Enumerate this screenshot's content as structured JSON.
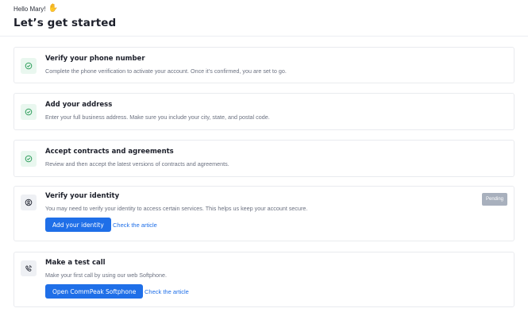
{
  "header": {
    "greeting": "Hello Mary!",
    "title": "Let’s get started"
  },
  "steps": [
    {
      "title": "Verify your phone number",
      "description": "Complete the phone verification to activate your account. Once it’s confirmed, you are set to go.",
      "status": "completed",
      "icon": "check-circle-icon"
    },
    {
      "title": "Add your address",
      "description": "Enter your full business address. Make sure you include your city, state, and postal code.",
      "status": "completed",
      "icon": "check-circle-icon"
    },
    {
      "title": "Accept contracts and agreements",
      "description": "Review and then accept the latest versions of contracts and agreements.",
      "status": "completed",
      "icon": "check-circle-icon"
    },
    {
      "title": "Verify your identity",
      "description": "You may need to verify your identity to access certain services. This helps us keep your account secure.",
      "status": "pending",
      "badge": "Pending",
      "icon": "user-circle-icon",
      "button_label": "Add your identity",
      "link_label": "Check the article"
    },
    {
      "title": "Make a test call",
      "description": "Make your first call by using our web Softphone.",
      "status": "todo",
      "icon": "phone-call-icon",
      "button_label": "Open CommPeak Softphone",
      "link_label": "Check the article"
    }
  ],
  "colors": {
    "primary": "#1f6fe8",
    "success": "#2e9e5b",
    "success_bg": "#e9f7ef",
    "badge_bg": "#a8b0bd"
  }
}
